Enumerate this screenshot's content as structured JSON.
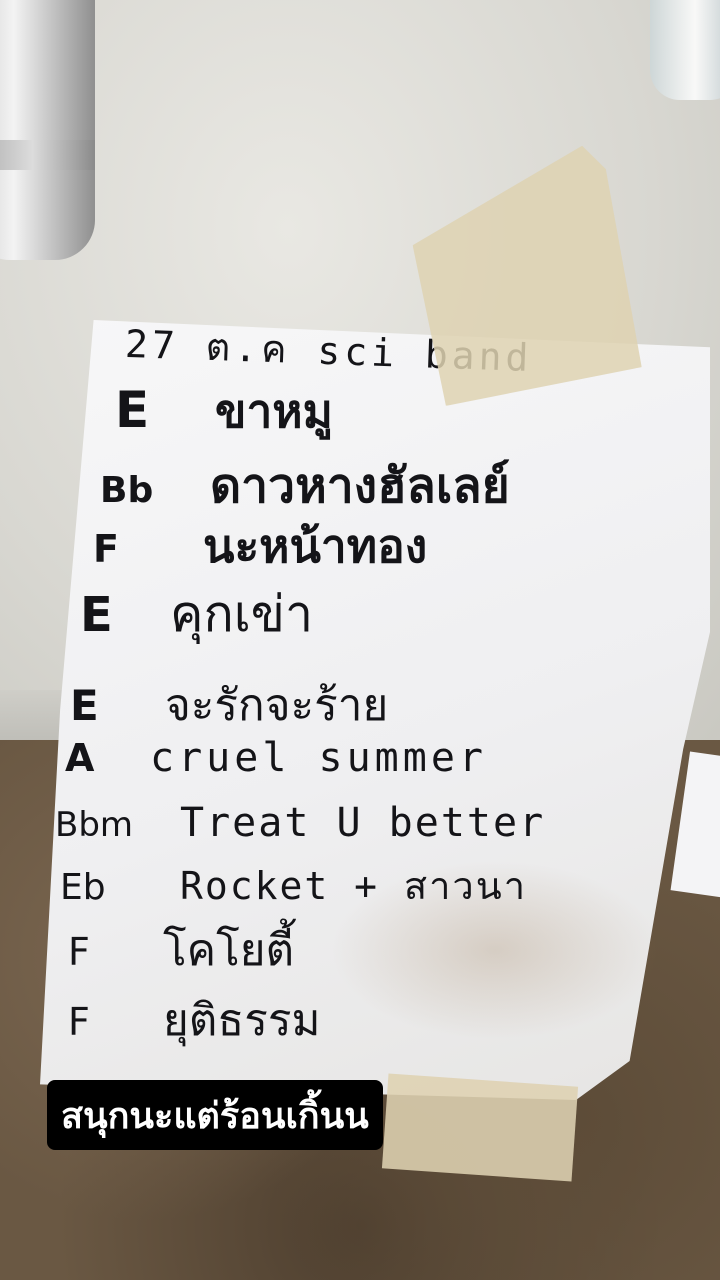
{
  "caption": "สนุกนะแต่ร้อนเกิ้นน",
  "setlist": {
    "header": "27 ต.ค sci band",
    "items": [
      {
        "key": "E",
        "song": "ขาหมู"
      },
      {
        "key": "Bb",
        "song": "ดาวหางฮัลเลย์"
      },
      {
        "key": "F",
        "song": "นะหน้าทอง"
      },
      {
        "key": "E",
        "song": "คุกเข่า"
      },
      {
        "key": "E",
        "song": "จะรักจะร้าย"
      },
      {
        "key": "A",
        "song": "cruel summer"
      },
      {
        "key": "Bbm",
        "song": "Treat U better"
      },
      {
        "key": "Eb",
        "song": "Rocket + สาวนา"
      },
      {
        "key": "F",
        "song": "โคโยตี้"
      },
      {
        "key": "F",
        "song": "ยุติธรรม"
      }
    ]
  }
}
